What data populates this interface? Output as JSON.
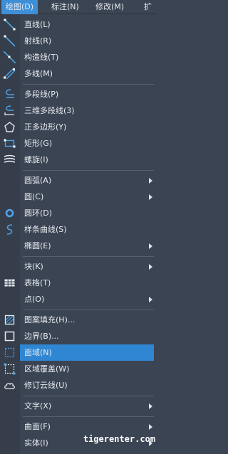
{
  "menubar": {
    "items": [
      {
        "label": "绘图(D)",
        "active": true
      },
      {
        "label": "标注(N)",
        "active": false
      },
      {
        "label": "修改(M)",
        "active": false
      },
      {
        "label": "扩",
        "active": false
      }
    ]
  },
  "menu": {
    "items": [
      {
        "label": "直线(L)",
        "icon": "line-icon"
      },
      {
        "label": "射线(R)",
        "icon": "ray-icon"
      },
      {
        "label": "构造线(T)",
        "icon": "construction-line-icon"
      },
      {
        "label": "多线(M)",
        "icon": "multiline-icon"
      },
      {
        "label": "多段线(P)",
        "icon": "polyline-icon"
      },
      {
        "label": "三维多段线(3)",
        "icon": "3d-polyline-icon"
      },
      {
        "label": "正多边形(Y)",
        "icon": "polygon-icon"
      },
      {
        "label": "矩形(G)",
        "icon": "rectangle-icon"
      },
      {
        "label": "螺旋(I)",
        "icon": "helix-icon"
      },
      {
        "label": "圆弧(A)",
        "submenu": true
      },
      {
        "label": "圆(C)",
        "submenu": true
      },
      {
        "label": "圆环(D)",
        "icon": "donut-icon"
      },
      {
        "label": "样条曲线(S)",
        "icon": "spline-icon"
      },
      {
        "label": "椭圆(E)",
        "submenu": true
      },
      {
        "label": "块(K)",
        "submenu": true
      },
      {
        "label": "表格(T)",
        "icon": "table-icon"
      },
      {
        "label": "点(O)",
        "submenu": true
      },
      {
        "label": "图案填充(H)...",
        "icon": "hatch-icon"
      },
      {
        "label": "边界(B)...",
        "icon": "boundary-icon"
      },
      {
        "label": "面域(N)",
        "icon": "region-icon",
        "highlighted": true
      },
      {
        "label": "区域覆盖(W)",
        "icon": "wipeout-icon"
      },
      {
        "label": "修订云线(U)",
        "icon": "revision-cloud-icon"
      },
      {
        "label": "文字(X)",
        "submenu": true
      },
      {
        "label": "曲面(F)",
        "submenu": true
      },
      {
        "label": "实体(I)",
        "submenu": true
      }
    ]
  },
  "watermark": "tigerenter.com",
  "colors": {
    "menu_bg": "#3b4453",
    "highlight": "#2f86d3",
    "icon_blue": "#4ea3e8",
    "text": "#e8ebf0"
  }
}
